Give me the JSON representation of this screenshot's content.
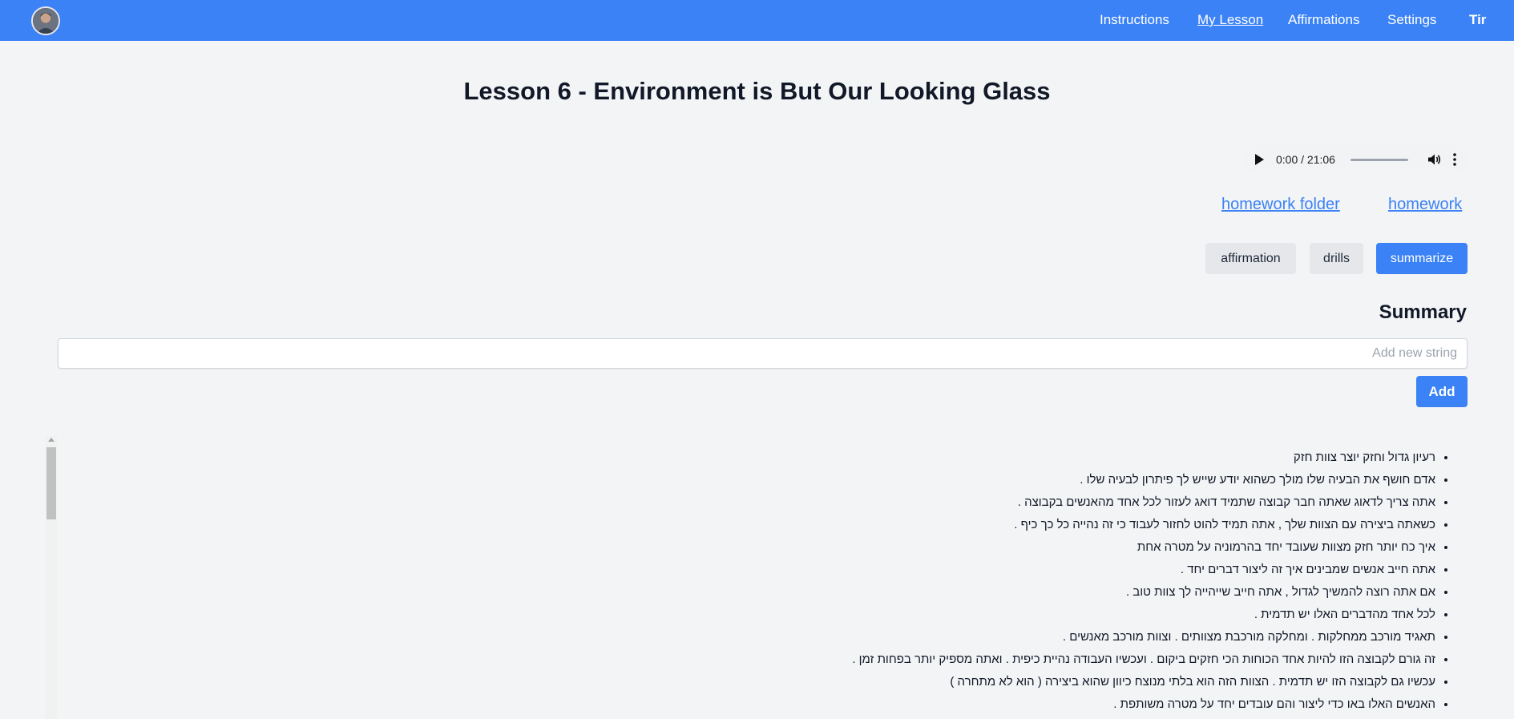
{
  "header": {
    "nav": [
      "Instructions",
      "My Lesson",
      "Affirmations",
      "Settings"
    ],
    "active": "My Lesson",
    "brand": "Tir",
    "avatar": "user-avatar"
  },
  "lesson": {
    "title": "Lesson 6 - Environment is But Our Looking Glass"
  },
  "audio": {
    "time": "0:00 / 21:06",
    "progress": 0
  },
  "links": {
    "homework_folder": "homework folder",
    "homework": "homework"
  },
  "tabs": {
    "affirmation": "affirmation",
    "drills": "drills",
    "summarize": "summarize",
    "active": "summarize"
  },
  "summary": {
    "heading": "Summary",
    "placeholder": "Add new string",
    "add_label": "Add",
    "items": [
      "רעיון גדול וחזק יוצר צוות חזק",
      "אדם חושף את הבעיה שלו מולך כשהוא יודע שייש לך פיתרון לבעיה שלו .",
      "אתה צריך לדאוג שאתה חבר קבוצה שתמיד דואג לעזור לכל אחד מהאנשים בקבוצה .",
      "כשאתה ביצירה עם הצוות שלך , אתה תמיד להוט לחזור לעבוד כי זה נהייה כל כך כיף .",
      "איך כח יותר חזק מצוות שעובד יחד בהרמוניה על מטרה אחת",
      "אתה חייב אנשים שמבינים איך זה ליצור דברים יחד .",
      "אם אתה רוצה להמשיך לגדול , אתה חייב שייהייה לך צוות טוב .",
      "לכל אחד מהדברים האלו יש תדמית .",
      "תאגיד מורכב ממחלקות . ומחלקה מורכבת מצוותים . וצוות מורכב מאנשים .",
      "זה גורם לקבוצה הזו להיות אחד הכוחות הכי חזקים ביקום . ועכשיו העבודה נהיית כיפית . ואתה מספיק יותר בפחות זמן .",
      "עכשיו גם לקבוצה הזו יש תדמית . הצוות הזה הוא בלתי מנוצח כיוון שהוא ביצירה ( הוא לא מתחרה )",
      "האנשים האלו באו כדי ליצור והם עובדים יחד על מטרה משותפת ."
    ]
  },
  "colors": {
    "primary": "#3b82f6",
    "background": "#f3f4f6",
    "button_gray": "#e5e7eb"
  }
}
